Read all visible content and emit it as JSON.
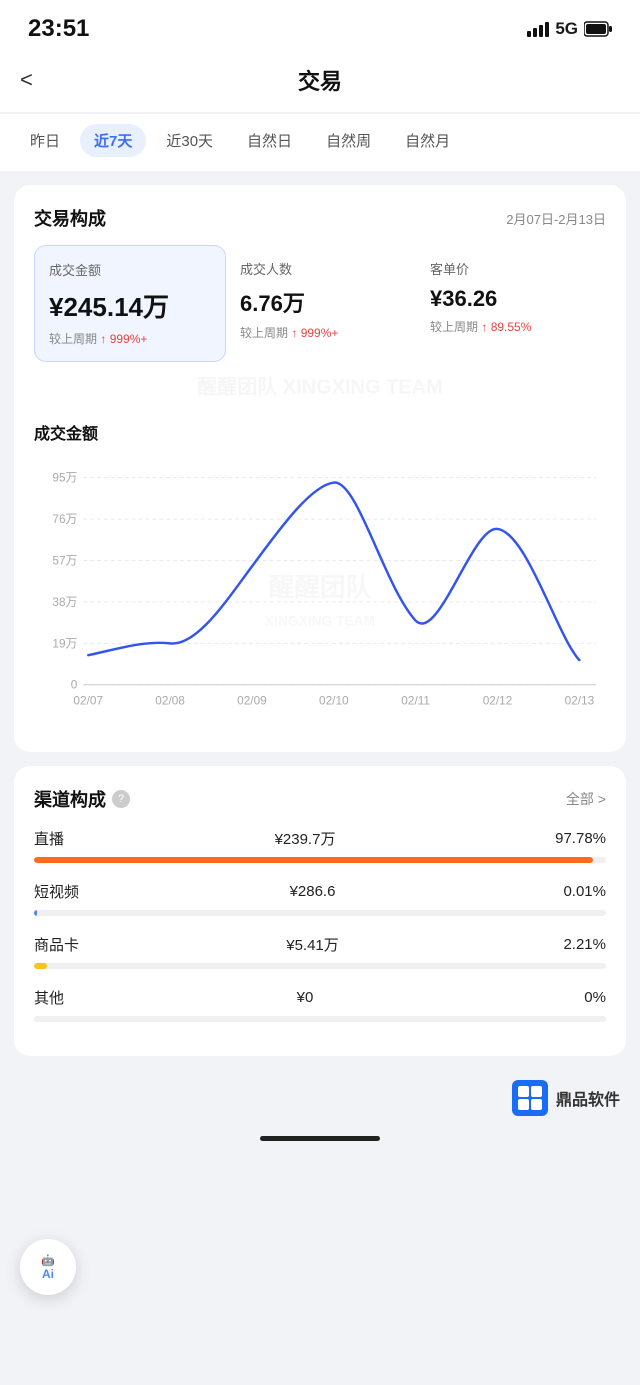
{
  "statusBar": {
    "time": "23:51",
    "signal": "5G"
  },
  "header": {
    "back": "<",
    "title": "交易"
  },
  "tabs": {
    "items": [
      {
        "label": "昨日",
        "active": false
      },
      {
        "label": "近7天",
        "active": true
      },
      {
        "label": "近30天",
        "active": false
      },
      {
        "label": "自然日",
        "active": false
      },
      {
        "label": "自然周",
        "active": false
      },
      {
        "label": "自然月",
        "active": false
      }
    ]
  },
  "transactionComposition": {
    "title": "交易构成",
    "dateRange": "2月07日-2月13日",
    "metrics": [
      {
        "label": "成交金额",
        "value": "¥245.14万",
        "changeLabel": "较上周期",
        "changeValue": "↑ 999%+",
        "selected": true
      },
      {
        "label": "成交人数",
        "value": "6.76万",
        "changeLabel": "较上周期",
        "changeValue": "↑ 999%+",
        "selected": false
      },
      {
        "label": "客单价",
        "value": "¥36.26",
        "changeLabel": "较上周期",
        "changeValue": "↑ 89.55%",
        "selected": false
      }
    ]
  },
  "chart": {
    "title": "成交金额",
    "yLabels": [
      "95万",
      "76万",
      "57万",
      "38万",
      "19万",
      "0"
    ],
    "xLabels": [
      "02/07",
      "02/08",
      "02/09",
      "02/10",
      "02/11",
      "02/12",
      "02/13"
    ]
  },
  "channelComposition": {
    "title": "渠道构成",
    "viewAll": "全部 >",
    "channels": [
      {
        "name": "直播",
        "amount": "¥239.7万",
        "pct": "97.78%",
        "fill": "fill-orange",
        "barWidth": "97.78"
      },
      {
        "name": "短视频",
        "amount": "¥286.6",
        "pct": "0.01%",
        "fill": "fill-blue",
        "barWidth": "0.5"
      },
      {
        "name": "商品卡",
        "amount": "¥5.41万",
        "pct": "2.21%",
        "fill": "fill-yellow",
        "barWidth": "2.21"
      },
      {
        "name": "其他",
        "amount": "¥0",
        "pct": "0%",
        "fill": "fill-gray",
        "barWidth": "0"
      }
    ]
  },
  "aiButton": {
    "label": "Ai"
  },
  "brand": {
    "name": "鼎品软件"
  }
}
